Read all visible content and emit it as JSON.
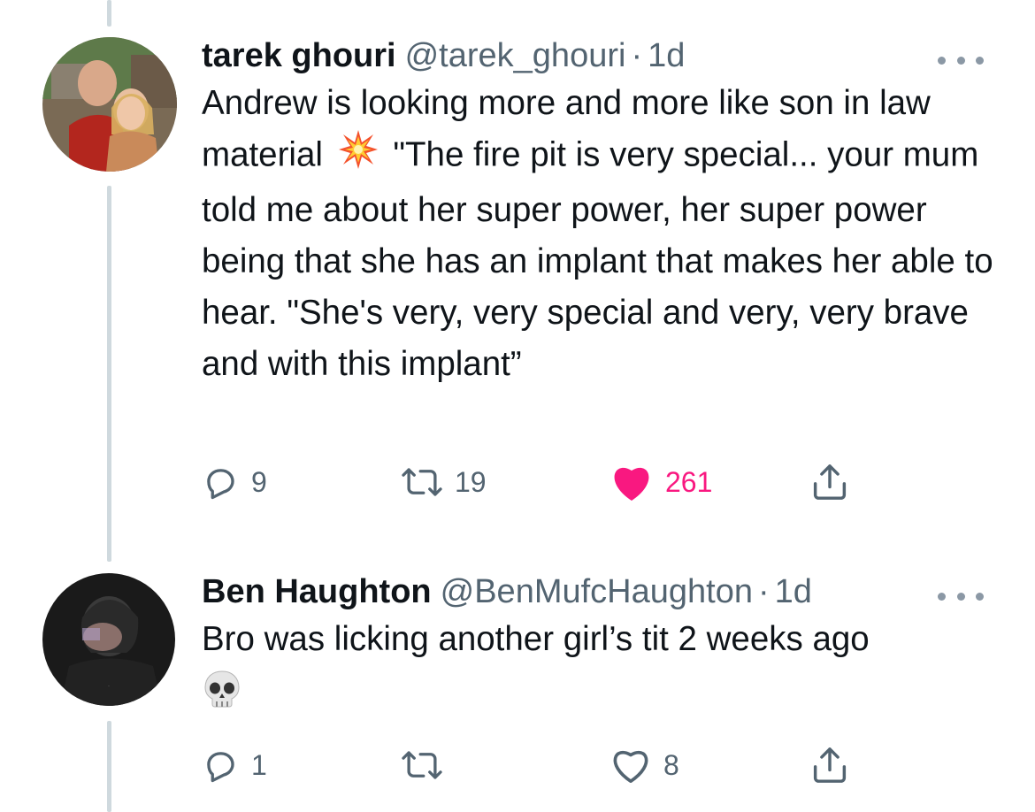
{
  "tweets": [
    {
      "name": "tarek ghouri",
      "handle": "@tarek_ghouri",
      "separator": "·",
      "time": "1d",
      "text_before_emoji": "Andrew is looking more and more like son in law material",
      "emoji": "collision-emoji",
      "text_after_emoji": "\"The fire pit is very special... your mum told me about her super power, her super power being that she has an implant that makes her able to hear. \"She's very, very special and very, very brave and with this implant”",
      "replies": "9",
      "retweets": "19",
      "likes": "261",
      "liked": true
    },
    {
      "name": "Ben Haughton",
      "handle": "@BenMufcHaughton",
      "separator": "·",
      "time": "1d",
      "text": "Bro was licking another girl’s tit 2 weeks ago",
      "emoji": "skull-emoji",
      "replies": "1",
      "retweets": "",
      "likes": "8",
      "liked": false
    }
  ],
  "colors": {
    "primary_text": "#0f1419",
    "secondary_text": "#536471",
    "like_pink": "#f91880",
    "thread_line": "#cfd9de"
  }
}
